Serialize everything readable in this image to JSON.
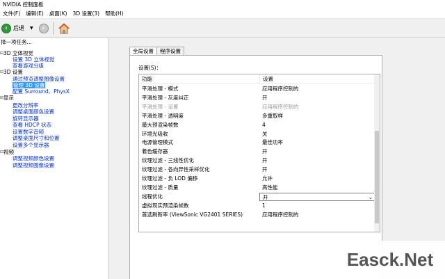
{
  "window": {
    "title": "NVIDIA 控制面板"
  },
  "menu": [
    "文件(F)",
    "编辑(E)",
    "桌面(K)",
    "3D 设置(3)",
    "帮助(H)"
  ],
  "toolbar": {
    "back_label": "后退",
    "dropdown_glyph": "▼"
  },
  "left": {
    "header": "择一项任务...",
    "tree": [
      {
        "label": "3D 立体视觉",
        "type": "cat",
        "expander": "⊟"
      },
      {
        "label": "设置 3D 立体视觉",
        "type": "link"
      },
      {
        "label": "查看游戏分级",
        "type": "link"
      },
      {
        "label": "3D 设置",
        "type": "cat",
        "expander": "⊟"
      },
      {
        "label": "通过预览调整图像设置",
        "type": "link"
      },
      {
        "label": "管理 3D 设置",
        "type": "selected"
      },
      {
        "label": "配置 Surround、PhysX",
        "type": "link"
      },
      {
        "label": "显示",
        "type": "cat",
        "expander": "⊟"
      },
      {
        "label": "更改分辨率",
        "type": "link"
      },
      {
        "label": "调整桌面颜色设置",
        "type": "link"
      },
      {
        "label": "旋转显示器",
        "type": "link"
      },
      {
        "label": "查看 HDCP 状态",
        "type": "link"
      },
      {
        "label": "设置数字音频",
        "type": "link"
      },
      {
        "label": "调整桌面尺寸和位置",
        "type": "link"
      },
      {
        "label": "设置多个显示器",
        "type": "link"
      },
      {
        "label": "视频",
        "type": "cat",
        "expander": "⊟"
      },
      {
        "label": "调整视频颜色设置",
        "type": "link"
      },
      {
        "label": "调整视频图像设置",
        "type": "link"
      }
    ]
  },
  "tabs": [
    "全局设置",
    "程序设置"
  ],
  "settings_label": "设置(S)：",
  "grid": {
    "headers": [
      "功能",
      "设置"
    ],
    "rows": [
      {
        "feature": "平滑处理 - 模式",
        "value": "应用程序控制的",
        "disabled": false
      },
      {
        "feature": "平滑处理 - 灰度纠正",
        "value": "开",
        "disabled": false
      },
      {
        "feature": "平滑处理 - 设置",
        "value": "应用程序控制的",
        "disabled": true
      },
      {
        "feature": "平滑处理 - 透明度",
        "value": "多重取样",
        "disabled": false
      },
      {
        "feature": "最大预渲染帧数",
        "value": "4",
        "disabled": false
      },
      {
        "feature": "环境光吸收",
        "value": "关",
        "disabled": false
      },
      {
        "feature": "电源管理模式",
        "value": "最佳功率",
        "disabled": false
      },
      {
        "feature": "着色缓存器",
        "value": "开",
        "disabled": false
      },
      {
        "feature": "纹理过滤 - 三线性优化",
        "value": "开",
        "disabled": false
      },
      {
        "feature": "纹理过滤 - 各向异性采样优化",
        "value": "开",
        "disabled": false
      },
      {
        "feature": "纹理过滤 - 负 LOD 偏移",
        "value": "允许",
        "disabled": false
      },
      {
        "feature": "纹理过滤 - 质量",
        "value": "高性能",
        "disabled": false
      },
      {
        "feature": "线程优化",
        "value": "开",
        "disabled": false,
        "selected": true
      },
      {
        "feature": "虚拟现实预渲染帧数",
        "value": "1",
        "disabled": false
      },
      {
        "feature": "首选刷新率 (ViewSonic VG2401 SERIES)",
        "value": "应用程序控制的",
        "disabled": false
      }
    ]
  },
  "watermark": "Easck.Net"
}
